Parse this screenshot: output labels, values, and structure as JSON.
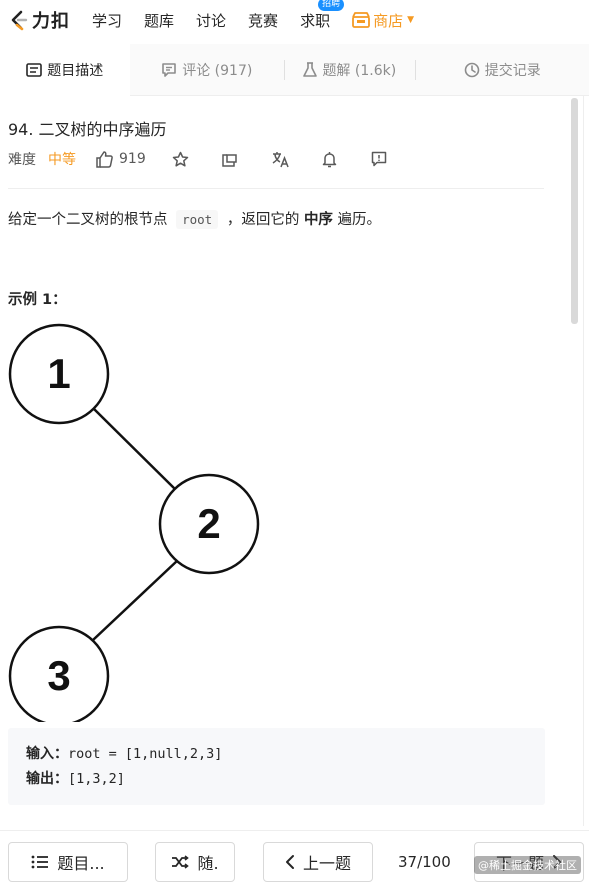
{
  "nav": {
    "logo_text": "力扣",
    "items": [
      "学习",
      "题库",
      "讨论",
      "竞赛",
      "求职"
    ],
    "job_badge": "招聘",
    "shop_label": "商店",
    "accent": "#f59a23"
  },
  "tabs": [
    {
      "label": "题目描述",
      "icon": "description-icon",
      "active": true
    },
    {
      "label": "评论 (917)",
      "icon": "comment-icon",
      "active": false
    },
    {
      "label": "题解 (1.6k)",
      "icon": "flask-icon",
      "active": false
    },
    {
      "label": "提交记录",
      "icon": "clock-icon",
      "active": false
    }
  ],
  "problem": {
    "title": "94. 二叉树的中序遍历",
    "difficulty_label": "难度",
    "difficulty": "中等",
    "likes": "919",
    "desc_prefix": "给定一个二叉树的根节点",
    "desc_code": "root",
    "desc_mid": "，返回它的",
    "desc_bold": "中序",
    "desc_suffix": "遍历。",
    "example_title": "示例 1：",
    "tree_nodes": [
      "1",
      "2",
      "3"
    ],
    "input_label": "输入：",
    "input_value": "root = [1,null,2,3]",
    "output_label": "输出：",
    "output_value": "[1,3,2]"
  },
  "bottom": {
    "list_label": "题目...",
    "random_label": "随.",
    "prev_label": "上一题",
    "page": "37/100",
    "next_label": "下一题"
  },
  "watermark": "@稀土掘金技术社区"
}
